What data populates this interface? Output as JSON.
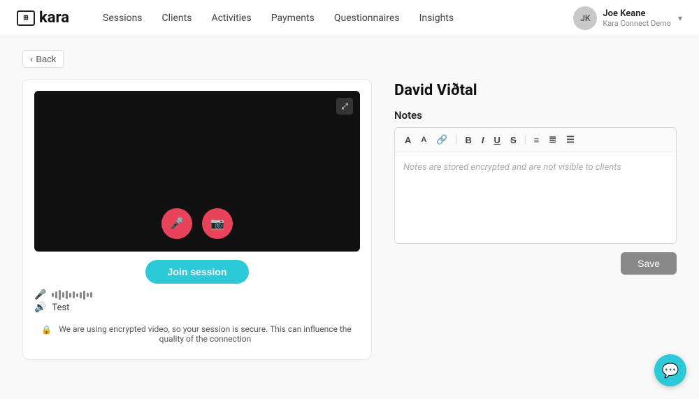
{
  "app": {
    "logo_text": "kara",
    "logo_icon": "⊞"
  },
  "nav": {
    "links": [
      {
        "label": "Sessions",
        "id": "sessions"
      },
      {
        "label": "Clients",
        "id": "clients"
      },
      {
        "label": "Activities",
        "id": "activities"
      },
      {
        "label": "Payments",
        "id": "payments"
      },
      {
        "label": "Questionnaires",
        "id": "questionnaires"
      },
      {
        "label": "Insights",
        "id": "insights"
      }
    ],
    "user": {
      "initials": "JK",
      "name": "Joe Keane",
      "subtitle": "Kara Connect Demo"
    }
  },
  "back_label": "Back",
  "client": {
    "name": "David Viðtal"
  },
  "notes": {
    "label": "Notes",
    "placeholder": "Notes are stored encrypted and are not visible to clients"
  },
  "toolbar": {
    "buttons": [
      {
        "label": "A",
        "id": "font-color"
      },
      {
        "label": "A",
        "id": "font-size"
      },
      {
        "label": "🔗",
        "id": "link"
      },
      {
        "label": "B",
        "id": "bold"
      },
      {
        "label": "I",
        "id": "italic"
      },
      {
        "label": "U",
        "id": "underline"
      },
      {
        "label": "S̶",
        "id": "strikethrough"
      },
      {
        "label": "≡",
        "id": "align-left"
      },
      {
        "label": "≣",
        "id": "list-ordered"
      },
      {
        "label": "☰",
        "id": "list-unordered"
      }
    ],
    "save_label": "Save"
  },
  "video": {
    "join_label": "Join session",
    "mic_label": "",
    "speaker_label": "Test",
    "security_notice": "We are using encrypted video, so your session is secure. This can influence the quality of the connection"
  },
  "waveform_bars": [
    6,
    10,
    14,
    8,
    12,
    7,
    10,
    5,
    9,
    13,
    6,
    8
  ]
}
